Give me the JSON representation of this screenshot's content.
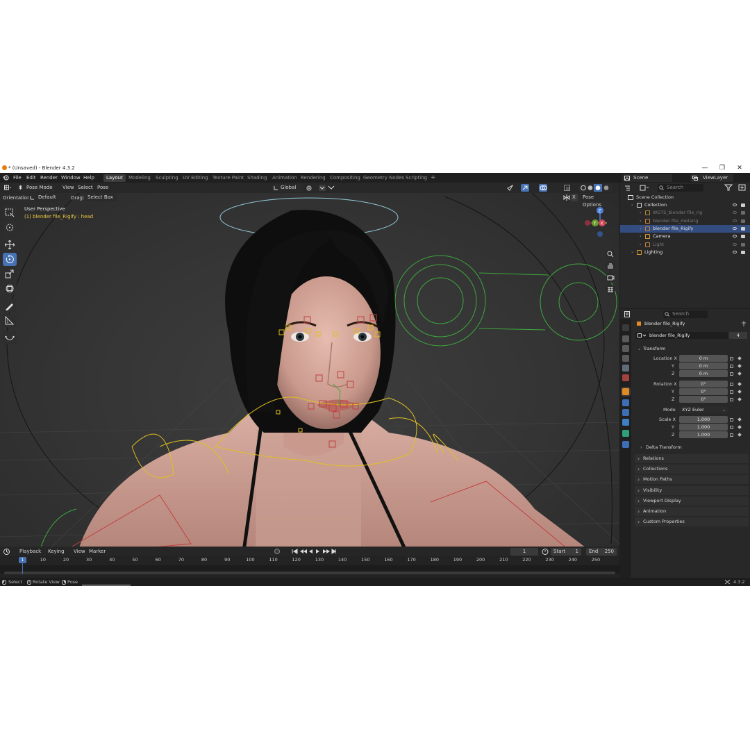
{
  "window": {
    "title": "* (Unsaved) - Blender 4.3.2",
    "minimize": "—",
    "maximize": "❐",
    "close": "✕"
  },
  "topbar": {
    "menus": [
      "File",
      "Edit",
      "Render",
      "Window",
      "Help"
    ],
    "workspaces": [
      "Layout",
      "Modeling",
      "Sculpting",
      "UV Editing",
      "Texture Paint",
      "Shading",
      "Animation",
      "Rendering",
      "Compositing",
      "Geometry Nodes",
      "Scripting"
    ],
    "active_workspace": "Layout",
    "add_workspace": "+",
    "scene": "Scene",
    "view_layer": "ViewLayer"
  },
  "viewport": {
    "mode": "Pose Mode",
    "menus": [
      "View",
      "Select",
      "Pose"
    ],
    "transform_orientation": "Global",
    "orientation_label": "Orientation:",
    "orientation_value": "Default",
    "drag_label": "Drag:",
    "drag_value": "Select Box",
    "pose_options": "Pose Options",
    "x_mirror": "X",
    "overlay_title": "User Perspective",
    "overlay_object": "(1) blender file_Rigify : head",
    "gizmo": {
      "z": "Z",
      "y": "Y",
      "x": "X"
    }
  },
  "timeline": {
    "menus": [
      "Playback",
      "Keying",
      "View",
      "Marker"
    ],
    "current_frame": "1",
    "start_label": "Start",
    "start": "1",
    "end_label": "End",
    "end": "250",
    "ruler": [
      "1",
      "10",
      "20",
      "30",
      "40",
      "50",
      "60",
      "70",
      "80",
      "90",
      "100",
      "110",
      "120",
      "130",
      "140",
      "150",
      "160",
      "170",
      "180",
      "190",
      "200",
      "210",
      "220",
      "230",
      "240",
      "250"
    ]
  },
  "statusbar": {
    "select": "Select",
    "rotate_view": "Rotate View",
    "pose": "Pose",
    "version": "4.3.2"
  },
  "outliner": {
    "search_placeholder": "Search",
    "root": "Scene Collection",
    "items": [
      {
        "label": "Collection",
        "depth": 1,
        "dim": false,
        "selected": false
      },
      {
        "label": "WGTS_blender file_rig",
        "depth": 2,
        "dim": true,
        "selected": false
      },
      {
        "label": "blender file_metarig",
        "depth": 2,
        "dim": true,
        "selected": false
      },
      {
        "label": "blender file_Rigify",
        "depth": 2,
        "dim": false,
        "selected": true
      },
      {
        "label": "Camera",
        "depth": 2,
        "dim": false,
        "selected": false
      },
      {
        "label": "Light",
        "depth": 2,
        "dim": true,
        "selected": false
      },
      {
        "label": "Lighting",
        "depth": 1,
        "dim": false,
        "selected": false
      }
    ]
  },
  "properties": {
    "search_placeholder": "Search",
    "object_title": "blender file_Rigify",
    "object_name": "blender file_Rigify",
    "users": "4",
    "transform_header": "Transform",
    "location_label": "Location X",
    "rotation_label": "Rotation X",
    "scale_label": "Scale X",
    "axis_y": "Y",
    "axis_z": "Z",
    "location": [
      "0 m",
      "0 m",
      "0 m"
    ],
    "rotation": [
      "0°",
      "0°",
      "0°"
    ],
    "mode_label": "Mode",
    "mode_value": "XYZ Euler",
    "scale": [
      "1.000",
      "1.000",
      "1.000"
    ],
    "delta_transform": "Delta Transform",
    "panels": [
      "Relations",
      "Collections",
      "Motion Paths",
      "Visibility",
      "Viewport Display",
      "Animation",
      "Custom Properties"
    ]
  },
  "colors": {
    "accent": "#4772b3",
    "selection": "#334d80",
    "panel": "#282828",
    "viewport": "#393939",
    "pose_bone": "#e0c020",
    "face_ctrl": "#c04040",
    "fk_ctrl": "#3ea83e"
  }
}
